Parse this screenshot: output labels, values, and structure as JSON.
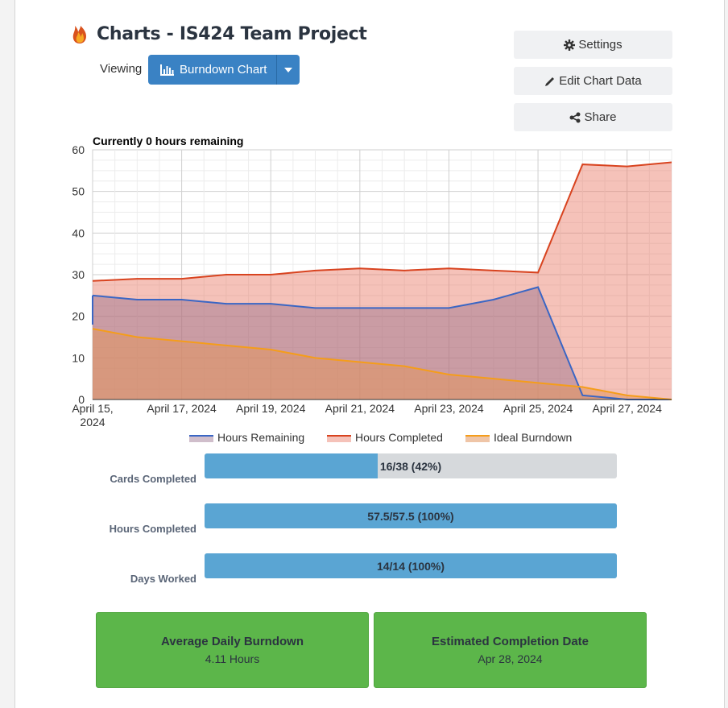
{
  "header": {
    "title": "Charts - IS424 Team Project",
    "viewing_label": "Viewing",
    "view_button_label": "Burndown Chart"
  },
  "side_buttons": {
    "settings": "Settings",
    "edit": "Edit Chart Data",
    "share": "Share"
  },
  "chart_data": {
    "type": "area",
    "title": "Currently 0 hours remaining",
    "xlabel": "",
    "ylabel": "",
    "ylim": [
      0,
      60
    ],
    "yticks": [
      "0",
      "10",
      "20",
      "30",
      "40",
      "50",
      "60"
    ],
    "x": [
      "Apr 15",
      "Apr 16",
      "Apr 17",
      "Apr 18",
      "Apr 19",
      "Apr 20",
      "Apr 21",
      "Apr 22",
      "Apr 23",
      "Apr 24",
      "Apr 25",
      "Apr 26",
      "Apr 27",
      "Apr 28"
    ],
    "xtick_labels": [
      {
        "day": 0,
        "lines": [
          "April 15,",
          "2024"
        ]
      },
      {
        "day": 2,
        "lines": [
          "April 17, 2024"
        ]
      },
      {
        "day": 4,
        "lines": [
          "April 19, 2024"
        ]
      },
      {
        "day": 6,
        "lines": [
          "April 21, 2024"
        ]
      },
      {
        "day": 8,
        "lines": [
          "April 23, 2024"
        ]
      },
      {
        "day": 10,
        "lines": [
          "April 25, 2024"
        ]
      },
      {
        "day": 12,
        "lines": [
          "April 27, 2024"
        ]
      }
    ],
    "grid": true,
    "legend_position": "bottom",
    "series": [
      {
        "name": "Hours Remaining",
        "color": "#3a66c4",
        "fill": "rgba(150,110,140,0.45)",
        "values": [
          25,
          24,
          24,
          23,
          23,
          22,
          22,
          22,
          22,
          24,
          27,
          1,
          0,
          0
        ]
      },
      {
        "name": "Hours Completed",
        "color": "#d8431f",
        "fill": "rgba(232,120,100,0.45)",
        "values": [
          28.5,
          29,
          29,
          30,
          30,
          31,
          31.5,
          31,
          31.5,
          31,
          30.5,
          56.5,
          56,
          57
        ]
      },
      {
        "name": "Ideal Burndown",
        "color": "#f59d1a",
        "fill": "rgba(225,150,95,0.55)",
        "values": [
          17,
          15,
          14,
          13,
          12,
          10,
          9,
          8,
          6,
          5,
          4,
          3,
          1,
          0
        ]
      }
    ]
  },
  "progress": [
    {
      "label": "Cards Completed",
      "text": "16/38 (42%)",
      "fraction": 0.42
    },
    {
      "label": "Hours Completed",
      "text": "57.5/57.5 (100%)",
      "fraction": 1.0
    },
    {
      "label": "Days Worked",
      "text": "14/14 (100%)",
      "fraction": 1.0
    }
  ],
  "stats": [
    {
      "title": "Average Daily Burndown",
      "value": "4.11 Hours"
    },
    {
      "title": "Estimated Completion Date",
      "value": "Apr 28, 2024"
    }
  ],
  "colors": {
    "accent": "#3a82c4",
    "success": "#5cb64a",
    "progress": "#5aa5d3"
  }
}
